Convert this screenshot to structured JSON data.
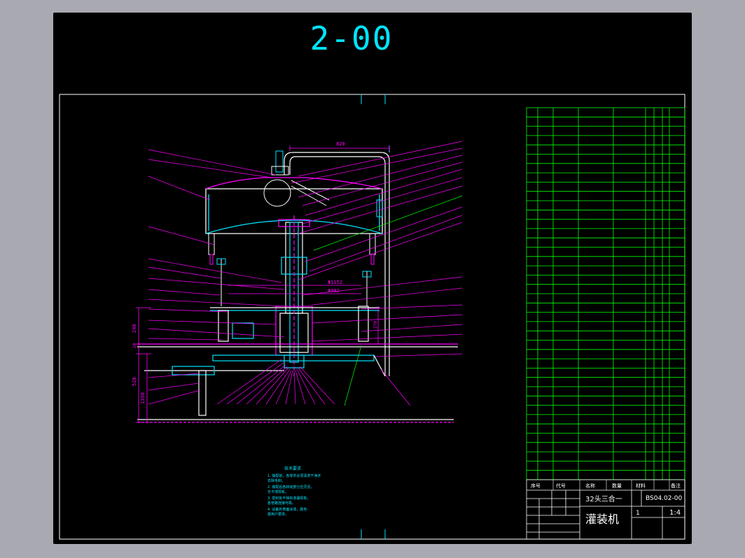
{
  "sheet": {
    "title": "2-00"
  },
  "drawing": {
    "dim_top": "820",
    "dim_diam_1": "Φ1152",
    "dim_diam_2": "Φ992",
    "dim_left_1": "240",
    "dim_left_2": "520",
    "dim_left_3": "1330",
    "dim_left_4": "20",
    "dim_right_1": "270"
  },
  "notes": {
    "heading": "技术要求",
    "lines": [
      "1. 装配前，各零件必须清洗干净并",
      "   去除毛刺。",
      "2. 装配后各转动部分应灵活，",
      "   无卡滞现象。",
      "3. 密封处不得有渗漏现象，",
      "   各管路连接可靠。",
      "4. 设备外表面涂漆，颜色",
      "   按用户要求。"
    ]
  },
  "title_block": {
    "header_cells": [
      "序号",
      "代号",
      "名称",
      "数量",
      "材料",
      "备注"
    ],
    "machine_subtitle": "32头三合一",
    "drawing_number": "BS04.02-00",
    "part_name": "灌装机",
    "quantity": "1",
    "scale": "1:4"
  },
  "colors": {
    "background": "#000000",
    "outer": "#a8a9b1",
    "cyan": "#00e5ff",
    "magenta": "#ff00ff",
    "white": "#ffffff",
    "green": "#00ff00",
    "blue": "#4a4aff"
  }
}
